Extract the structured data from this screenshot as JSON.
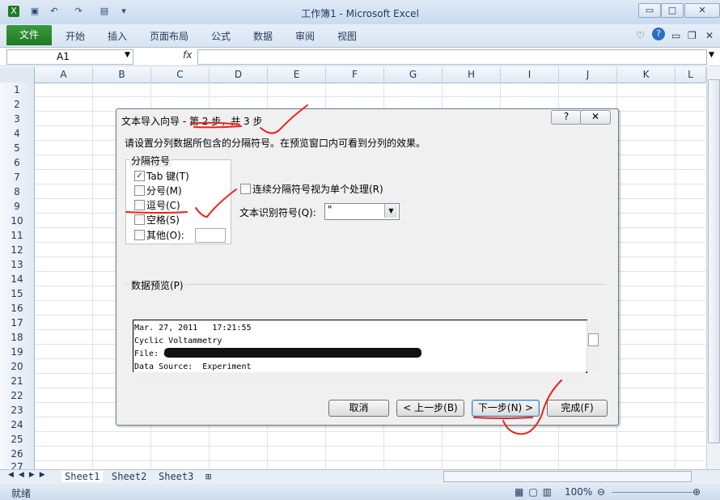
{
  "window": {
    "title": "工作簿1 - Microsoft Excel",
    "minimize": "▭",
    "maximize": "□",
    "close": "✕"
  },
  "ribbon": {
    "file_tab": "文件",
    "tabs": [
      "开始",
      "插入",
      "页面布局",
      "公式",
      "数据",
      "审阅",
      "视图"
    ]
  },
  "formula_bar": {
    "name_box": "A1",
    "fx": "fx",
    "value": ""
  },
  "grid": {
    "columns": [
      "A",
      "B",
      "C",
      "D",
      "E",
      "F",
      "G",
      "H",
      "I",
      "J",
      "K",
      "L"
    ],
    "rows": [
      "1",
      "2",
      "3",
      "4",
      "5",
      "6",
      "7",
      "8",
      "9",
      "10",
      "11",
      "12",
      "13",
      "14",
      "15",
      "16",
      "17",
      "18",
      "19",
      "20",
      "21",
      "22",
      "23",
      "24",
      "25",
      "26",
      "27"
    ]
  },
  "sheets": [
    "Sheet1",
    "Sheet2",
    "Sheet3"
  ],
  "status": {
    "ready": "就绪",
    "zoom": "100%"
  },
  "dialog": {
    "title": "文本导入向导 - 第 2 步，共 3 步",
    "help": "?",
    "close": "✕",
    "instruction": "请设置分列数据所包含的分隔符号。在预览窗口内可看到分列的效果。",
    "delimiters": {
      "legend": "分隔符号",
      "items": [
        {
          "label": "Tab 键(T)",
          "checked": true
        },
        {
          "label": "分号(M)",
          "checked": false
        },
        {
          "label": "逗号(C)",
          "checked": false
        },
        {
          "label": "空格(S)",
          "checked": false
        },
        {
          "label": "其他(O):",
          "checked": false
        }
      ]
    },
    "consecutive_label": "连续分隔符号视为单个处理(R)",
    "qualifier_label": "文本识别符号(Q):",
    "qualifier_value": "\"",
    "preview": {
      "legend": "数据预览(P)",
      "lines": [
        "Mar. 27, 2011   17:21:55",
        "Cyclic Voltammetry",
        "File: d:\\",
        "Data Source:  Experiment"
      ]
    },
    "buttons": {
      "cancel": "取消",
      "back": "< 上一步(B)",
      "next": "下一步(N) >",
      "finish": "完成(F)"
    }
  }
}
